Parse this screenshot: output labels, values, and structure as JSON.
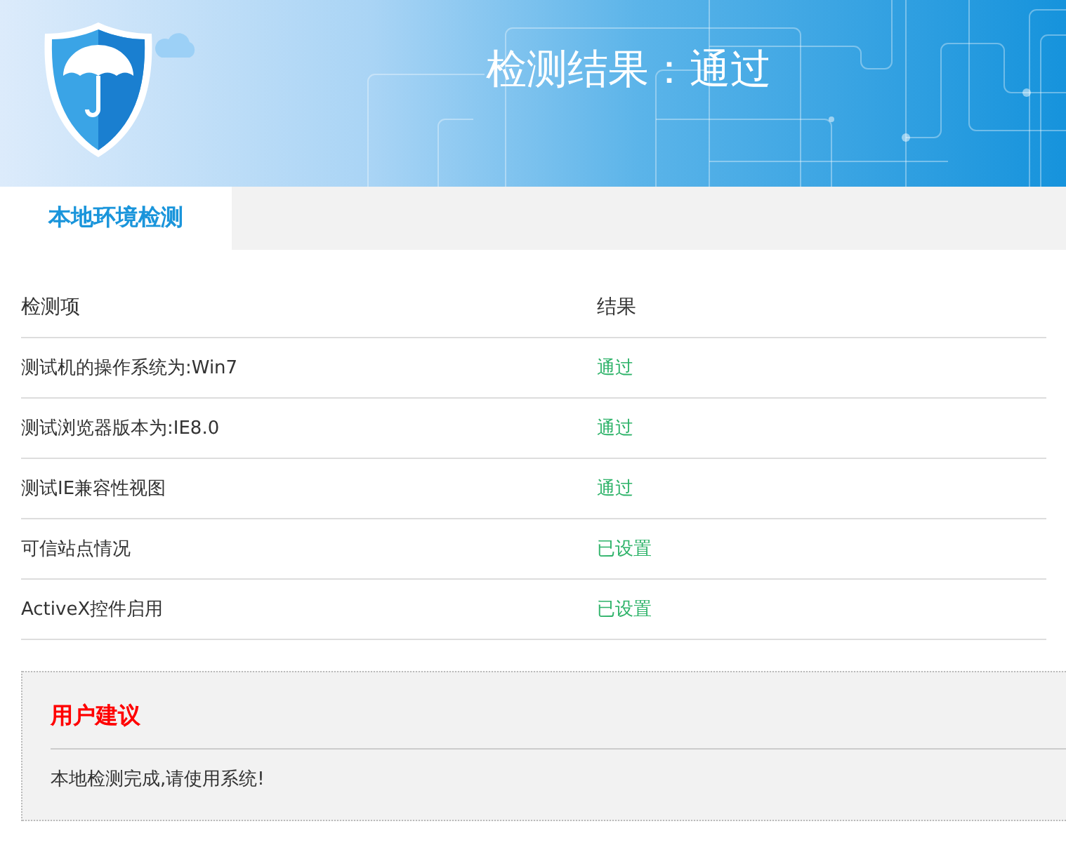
{
  "header": {
    "title": "检测结果：通过"
  },
  "tabs": [
    {
      "label": "本地环境检测",
      "selected": true
    }
  ],
  "table": {
    "columns": [
      "检测项",
      "结果"
    ],
    "rows": [
      {
        "item": "测试机的操作系统为:Win7",
        "result": "通过"
      },
      {
        "item": "测试浏览器版本为:IE8.0",
        "result": "通过"
      },
      {
        "item": "测试IE兼容性视图",
        "result": "通过"
      },
      {
        "item": "可信站点情况",
        "result": "已设置"
      },
      {
        "item": "ActiveX控件启用",
        "result": "已设置"
      }
    ]
  },
  "advice": {
    "title": "用户建议",
    "text": "本地检测完成,请使用系统!"
  }
}
